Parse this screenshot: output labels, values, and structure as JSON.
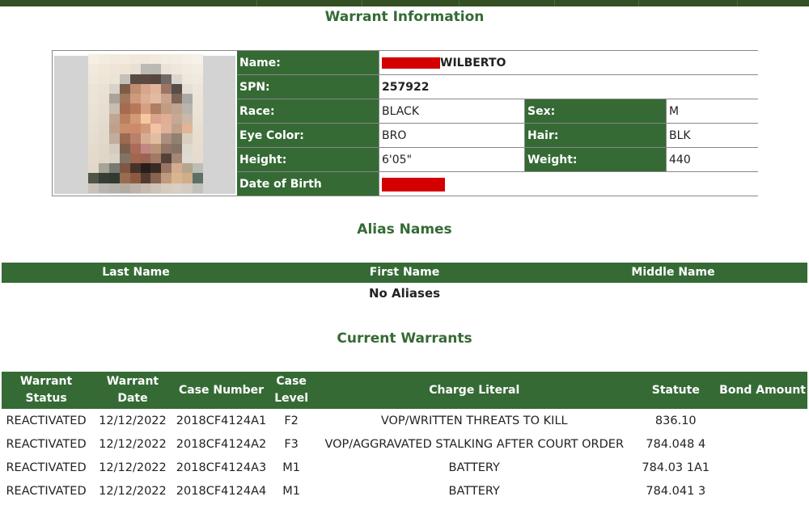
{
  "colors": {
    "header_green": "#356a35",
    "topbar_green": "#344f24",
    "redaction_red": "#d40000",
    "border_gray": "#888888"
  },
  "topbar": {
    "segments": 7
  },
  "warrant_info": {
    "title": "Warrant Information",
    "photo": {
      "alt": "pixelated-mugshot"
    },
    "labels": {
      "name": "Name:",
      "spn": "SPN:",
      "race": "Race:",
      "sex": "Sex:",
      "eye_color": "Eye Color:",
      "hair": "Hair:",
      "height": "Height:",
      "weight": "Weight:",
      "dob": "Date of Birth"
    },
    "values": {
      "name_redacted": true,
      "name_visible": "WILBERTO",
      "spn": "257922",
      "race": "BLACK",
      "sex": "M",
      "eye_color": "BRO",
      "hair": "BLK",
      "height": "6'05\"",
      "weight": "440",
      "dob_redacted": true
    }
  },
  "alias": {
    "title": "Alias Names",
    "columns": [
      "Last Name",
      "First Name",
      "Middle Name"
    ],
    "empty_message": "No Aliases"
  },
  "warrants": {
    "title": "Current Warrants",
    "columns": [
      "Warrant Status",
      "Warrant Date",
      "Case Number",
      "Case Level",
      "Charge Literal",
      "Statute",
      "Bond Amount"
    ],
    "rows": [
      [
        "REACTIVATED",
        "12/12/2022",
        "2018CF4124A1",
        "F2",
        "VOP/WRITTEN THREATS TO KILL",
        "836.10",
        ""
      ],
      [
        "REACTIVATED",
        "12/12/2022",
        "2018CF4124A2",
        "F3",
        "VOP/AGGRAVATED STALKING AFTER COURT ORDER",
        "784.048 4",
        ""
      ],
      [
        "REACTIVATED",
        "12/12/2022",
        "2018CF4124A3",
        "M1",
        "BATTERY",
        "784.03 1A1",
        ""
      ],
      [
        "REACTIVATED",
        "12/12/2022",
        "2018CF4124A4",
        "M1",
        "BATTERY",
        "784.041 3",
        ""
      ]
    ]
  }
}
